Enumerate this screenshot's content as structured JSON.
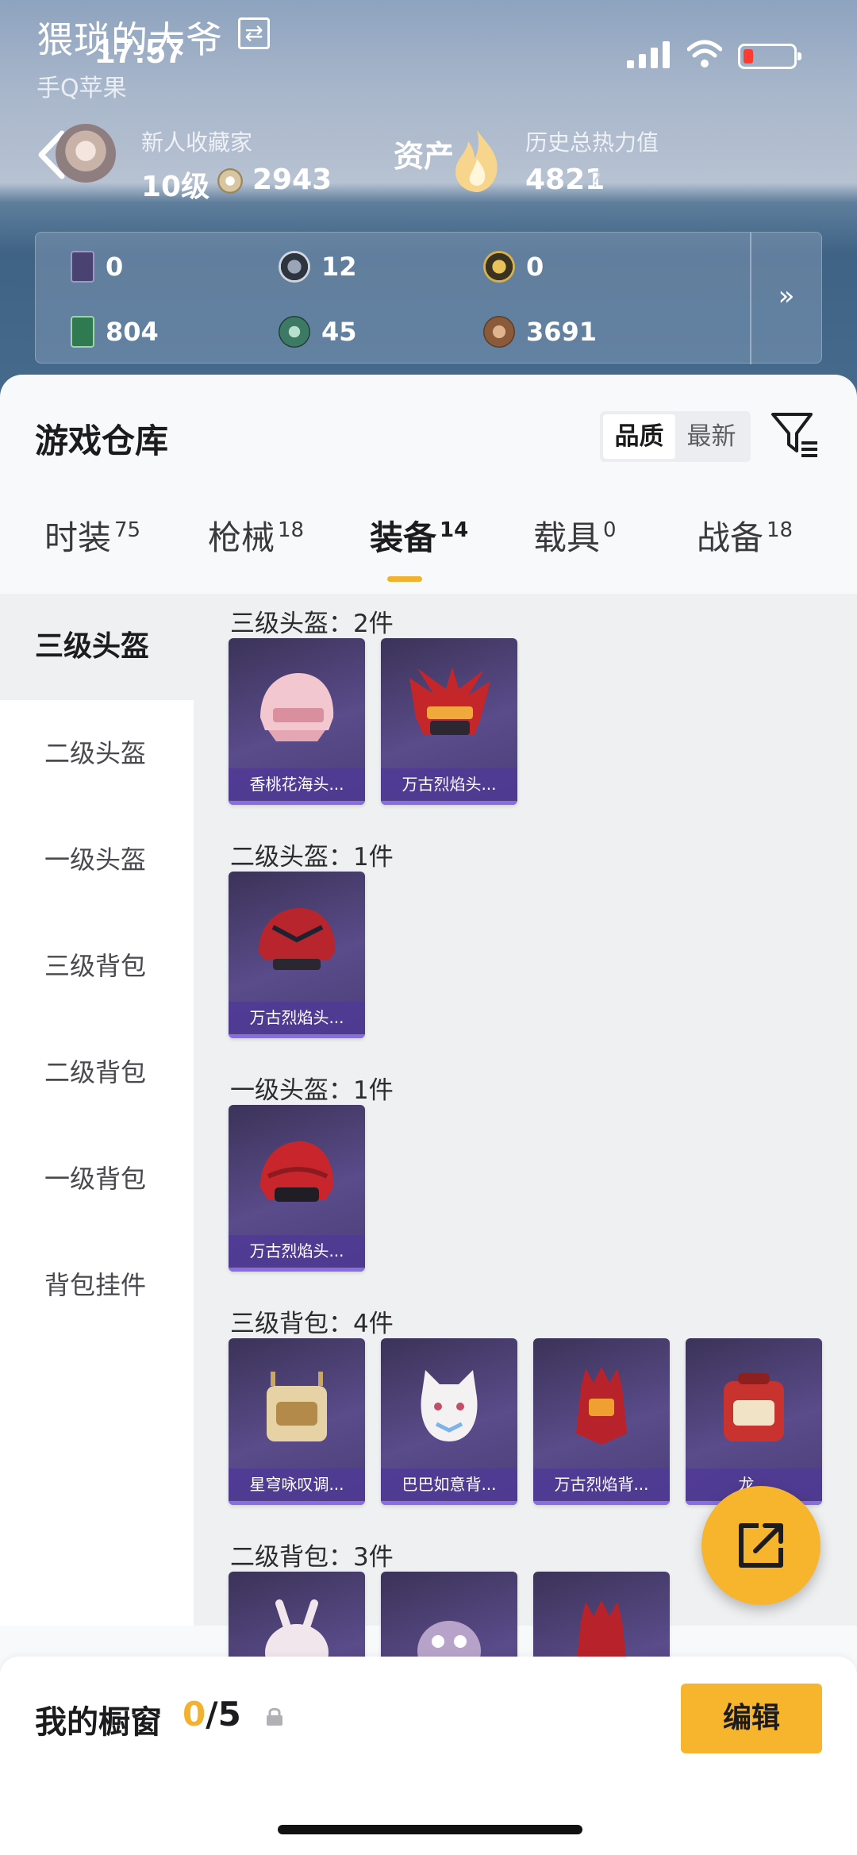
{
  "status_bar": {
    "time": "17:57"
  },
  "profile": {
    "name": "猥琐的大爷",
    "platform": "手Q苹果",
    "rank_title": "新人收藏家",
    "level": "10级",
    "coins": "2943",
    "asset_label": "资产",
    "heat_label": "历史总热力值",
    "heat_value": "4821",
    "help": "?"
  },
  "currencies": [
    {
      "icon": "card-icon",
      "value": "0",
      "color": "#4a4270"
    },
    {
      "icon": "s-token-icon",
      "value": "12",
      "color": "#2f3540"
    },
    {
      "icon": "gold-token-icon",
      "value": "0",
      "color": "#3a3220"
    },
    {
      "icon": "green-card-icon",
      "value": "804",
      "color": "#2f7a50"
    },
    {
      "icon": "jade-icon",
      "value": "45",
      "color": "#3d7a66"
    },
    {
      "icon": "bronze-coin-icon",
      "value": "3691",
      "color": "#8a5a3a"
    }
  ],
  "warehouse": {
    "title": "游戏仓库",
    "sort_quality": "品质",
    "sort_newest": "最新"
  },
  "tabs": [
    {
      "label": "时装",
      "count": "75"
    },
    {
      "label": "枪械",
      "count": "18"
    },
    {
      "label": "装备",
      "count": "14"
    },
    {
      "label": "载具",
      "count": "0"
    },
    {
      "label": "战备",
      "count": "18"
    }
  ],
  "sidebar": [
    "三级头盔",
    "二级头盔",
    "一级头盔",
    "三级背包",
    "二级背包",
    "一级背包",
    "背包挂件"
  ],
  "sections": [
    {
      "title": "三级头盔：2件",
      "items": [
        "香桃花海头...",
        "万古烈焰头..."
      ]
    },
    {
      "title": "二级头盔：1件",
      "items": [
        "万古烈焰头..."
      ]
    },
    {
      "title": "一级头盔：1件",
      "items": [
        "万古烈焰头..."
      ]
    },
    {
      "title": "三级背包：4件",
      "items": [
        "星穹咏叹调...",
        "巴巴如意背...",
        "万古烈焰背...",
        "龙..."
      ]
    },
    {
      "title": "二级背包：3件",
      "items": [
        "",
        "",
        ""
      ]
    }
  ],
  "showcase": {
    "label": "我的橱窗",
    "current": "0",
    "total": "/5",
    "edit": "编辑"
  },
  "colors": {
    "accent": "#f6b52d",
    "card": "#5a4b8a",
    "card_label": "#503a96"
  }
}
